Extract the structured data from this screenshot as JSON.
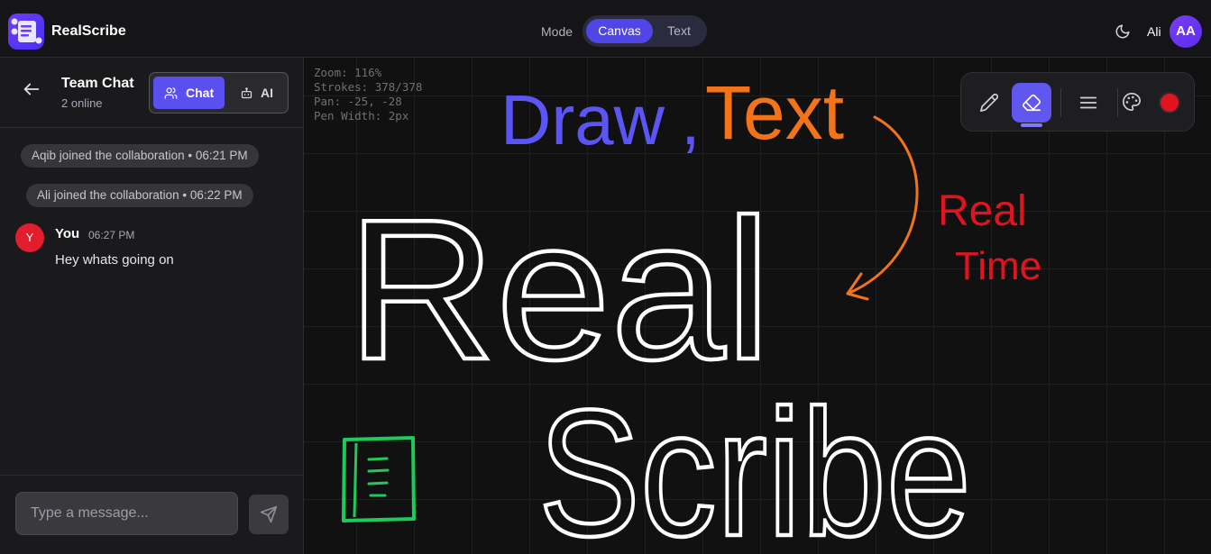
{
  "app": {
    "name": "RealScribe",
    "mode_label": "Mode",
    "modes": [
      "Canvas",
      "Text"
    ],
    "active_mode": "Canvas",
    "user_name": "Ali",
    "user_initials": "AA",
    "accent_color": "#4f46e5"
  },
  "sidebar": {
    "title": "Team Chat",
    "subtitle": "2 online",
    "tabs": {
      "chat": "Chat",
      "ai": "AI"
    },
    "active_tab": "Chat",
    "system_messages": [
      "Aqib joined the collaboration • 06:21 PM",
      "Ali joined the collaboration • 06:22 PM"
    ],
    "messages": [
      {
        "avatar": "Y",
        "author": "You",
        "time": "06:27 PM",
        "text": "Hey whats going on"
      }
    ],
    "input_placeholder": "Type a message..."
  },
  "canvas": {
    "stats": {
      "zoom": "Zoom: 116%",
      "strokes": "Strokes: 378/378",
      "pan": "Pan: -25, -28",
      "pen_width": "Pen Width: 2px"
    },
    "tools": [
      "pen-tool",
      "eraser-tool",
      "stroke-width-tool",
      "palette-tool"
    ],
    "active_tool": "eraser-tool",
    "current_color": "#e0141e",
    "drawing_text": {
      "headline_part1": "Draw",
      "headline_comma": ",",
      "headline_part2": "Text",
      "side_line1": "Real",
      "side_line2": "Time",
      "big_word1": "Real",
      "big_word2": "Scribe"
    },
    "drawing_colors": {
      "draw": "#5b55f5",
      "text": "#f27318",
      "realtime": "#e0141e",
      "outline": "#ffffff",
      "doc_icon": "#1fc95a"
    }
  }
}
